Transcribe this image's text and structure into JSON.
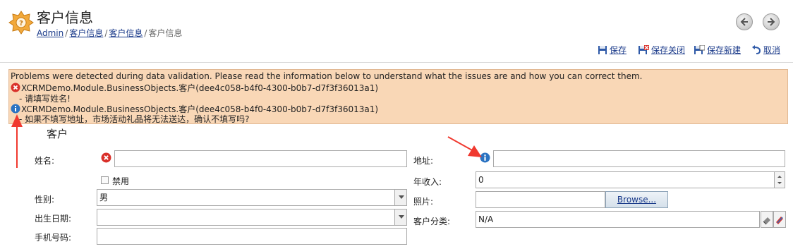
{
  "header": {
    "title": "客户信息",
    "breadcrumb": [
      "Admin",
      "客户信息",
      "客户信息",
      "客户信息"
    ]
  },
  "toolbar": {
    "save": "保存",
    "save_close": "保存关闭",
    "save_new": "保存新建",
    "cancel": "取消"
  },
  "validation": {
    "summary": "Problems were detected during data validation. Please read the information below to understand what the issues are and how you can correct them.",
    "items": [
      {
        "type": "error",
        "object": "XCRMDemo.Module.BusinessObjects.客户(dee4c058-b4f0-4300-b0b7-d7f3f36013a1)",
        "message": "- 请填写姓名!"
      },
      {
        "type": "info",
        "object": "XCRMDemo.Module.BusinessObjects.客户(dee4c058-b4f0-4300-b0b7-d7f3f36013a1)",
        "message": "- 如果不填写地址，市场活动礼品将无法送达，确认不填写吗?"
      }
    ]
  },
  "form": {
    "section_title": "客户",
    "name_label": "姓名:",
    "name_value": "",
    "disabled_label": "禁用",
    "gender_label": "性别:",
    "gender_value": "男",
    "birthdate_label": "出生日期:",
    "birthdate_value": "",
    "mobile_label": "手机号码:",
    "mobile_value": "",
    "address_label": "地址:",
    "address_value": "",
    "income_label": "年收入:",
    "income_value": "0",
    "photo_label": "照片:",
    "browse_label": "Browse...",
    "category_label": "客户分类:",
    "category_value": "N/A"
  },
  "colors": {
    "validation_bg": "#f9d7b6",
    "error_red": "#d9302a",
    "info_blue": "#2b73c2",
    "link_blue": "#1a3a8a",
    "annotation_arrow": "#f0392f"
  }
}
